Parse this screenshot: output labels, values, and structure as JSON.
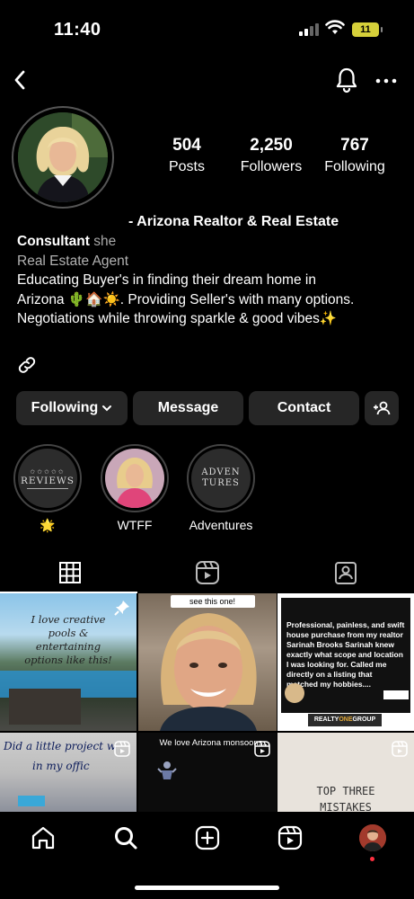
{
  "status_bar": {
    "time": "11:40",
    "battery": "11"
  },
  "nav": {
    "back_icon": "chevron-left-icon",
    "bell_icon": "bell-icon",
    "more_icon": "more-horizontal-icon"
  },
  "profile": {
    "stats": [
      {
        "value": "504",
        "label": "Posts"
      },
      {
        "value": "2,250",
        "label": "Followers"
      },
      {
        "value": "767",
        "label": "Following"
      }
    ],
    "name": "- Arizona Realtor & Real Estate",
    "bio_line1_bold": "Consultant",
    "bio_line1_category": "she",
    "bio_role": "Real Estate Agent",
    "bio_text1": "Educating Buyer's in finding their dream home in",
    "bio_text2": "Arizona 🌵🏠☀️. Providing Seller's with many options.",
    "bio_text3": "Negotiations while throwing sparkle & good vibes✨"
  },
  "buttons": {
    "following": "Following",
    "message": "Message",
    "contact": "Contact"
  },
  "highlights": [
    {
      "label": "🌟",
      "cover_text": "REVIEWS"
    },
    {
      "label": "WTFF",
      "cover_text": ""
    },
    {
      "label": "Adventures",
      "cover_text_1": "ADVEN",
      "cover_text_2": "TURES"
    }
  ],
  "grid": {
    "post1_text": "I love creative pools & entertaining options like this!",
    "post2_text": "see this one!",
    "post3_text": "Professional, painless, and swift house purchase from my realtor Sarinah Brooks Sarinah knew exactly what scope and location I was looking for. Called me directly on a listing that matched my hobbies....",
    "post3_brand_a": "REALTY",
    "post3_brand_b": "ONE",
    "post3_brand_c": "GROUP",
    "post4_text_1": "Did a little project w",
    "post4_text_2": "in my offic",
    "post5_text": "We love Arizona monsoons...",
    "post6_text_1": "TOP THREE",
    "post6_text_2": "MISTAKES"
  },
  "colors": {
    "background": "#000000",
    "button_bg": "#262626",
    "secondary_text": "#a8a8a8",
    "notification_dot": "#ff3040"
  }
}
